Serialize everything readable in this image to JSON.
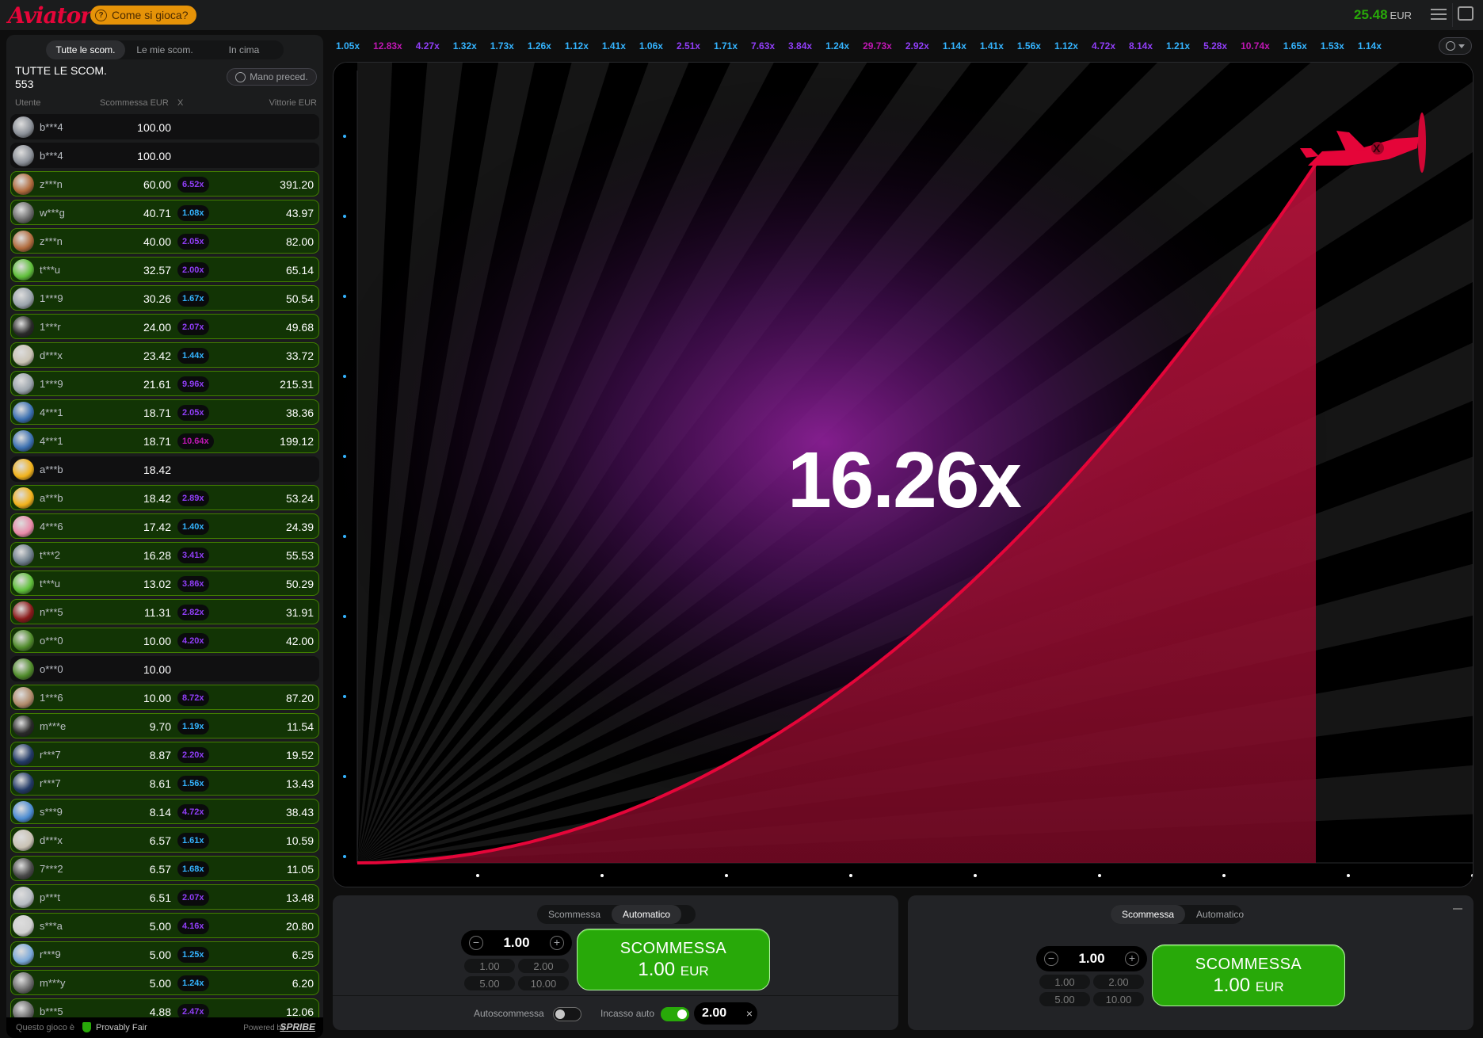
{
  "header": {
    "logo": "Aviator",
    "how_to": "Come si gioca?",
    "balance": "25.48",
    "currency": "EUR"
  },
  "left_panel": {
    "tabs": [
      "Tutte le scom.",
      "Le mie scom.",
      "In cima"
    ],
    "title": "TUTTE LE SCOM.",
    "count": "553",
    "prev_button": "Mano preced.",
    "col_user": "Utente",
    "col_bet": "Scommessa EUR",
    "col_x": "X",
    "col_win": "Vittorie EUR",
    "rows": [
      {
        "user": "b***4",
        "bet": "100.00",
        "mult": "",
        "win": "",
        "mc": "",
        "ac": "#8a8f97"
      },
      {
        "user": "b***4",
        "bet": "100.00",
        "mult": "",
        "win": "",
        "mc": "",
        "ac": "#8a8f97"
      },
      {
        "user": "z***n",
        "bet": "60.00",
        "mult": "6.52x",
        "win": "391.20",
        "mc": "#913ef8",
        "ac": "#b06a3c"
      },
      {
        "user": "w***g",
        "bet": "40.71",
        "mult": "1.08x",
        "win": "43.97",
        "mc": "#34b4ff",
        "ac": "#6a6a6a"
      },
      {
        "user": "z***n",
        "bet": "40.00",
        "mult": "2.05x",
        "win": "82.00",
        "mc": "#913ef8",
        "ac": "#b06a3c"
      },
      {
        "user": "t***u",
        "bet": "32.57",
        "mult": "2.00x",
        "win": "65.14",
        "mc": "#913ef8",
        "ac": "#5fbf3a"
      },
      {
        "user": "1***9",
        "bet": "30.26",
        "mult": "1.67x",
        "win": "50.54",
        "mc": "#34b4ff",
        "ac": "#9aa3ab"
      },
      {
        "user": "1***r",
        "bet": "24.00",
        "mult": "2.07x",
        "win": "49.68",
        "mc": "#913ef8",
        "ac": "#2a2a2a"
      },
      {
        "user": "d***x",
        "bet": "23.42",
        "mult": "1.44x",
        "win": "33.72",
        "mc": "#34b4ff",
        "ac": "#c9c2b4"
      },
      {
        "user": "1***9",
        "bet": "21.61",
        "mult": "9.96x",
        "win": "215.31",
        "mc": "#913ef8",
        "ac": "#9aa3ab"
      },
      {
        "user": "4***1",
        "bet": "18.71",
        "mult": "2.05x",
        "win": "38.36",
        "mc": "#913ef8",
        "ac": "#3a6fb0"
      },
      {
        "user": "4***1",
        "bet": "18.71",
        "mult": "10.64x",
        "win": "199.12",
        "mc": "#c017b4",
        "ac": "#3a6fb0"
      },
      {
        "user": "a***b",
        "bet": "18.42",
        "mult": "",
        "win": "",
        "mc": "",
        "ac": "#f2b21b"
      },
      {
        "user": "a***b",
        "bet": "18.42",
        "mult": "2.89x",
        "win": "53.24",
        "mc": "#913ef8",
        "ac": "#f2b21b"
      },
      {
        "user": "4***6",
        "bet": "17.42",
        "mult": "1.40x",
        "win": "24.39",
        "mc": "#34b4ff",
        "ac": "#e88aa8"
      },
      {
        "user": "t***2",
        "bet": "16.28",
        "mult": "3.41x",
        "win": "55.53",
        "mc": "#913ef8",
        "ac": "#6d7d8a"
      },
      {
        "user": "t***u",
        "bet": "13.02",
        "mult": "3.86x",
        "win": "50.29",
        "mc": "#913ef8",
        "ac": "#5fbf3a"
      },
      {
        "user": "n***5",
        "bet": "11.31",
        "mult": "2.82x",
        "win": "31.91",
        "mc": "#913ef8",
        "ac": "#8a1a1a"
      },
      {
        "user": "o***0",
        "bet": "10.00",
        "mult": "4.20x",
        "win": "42.00",
        "mc": "#913ef8",
        "ac": "#4f8a2a"
      },
      {
        "user": "o***0",
        "bet": "10.00",
        "mult": "",
        "win": "",
        "mc": "",
        "ac": "#4f8a2a"
      },
      {
        "user": "1***6",
        "bet": "10.00",
        "mult": "8.72x",
        "win": "87.20",
        "mc": "#913ef8",
        "ac": "#b08a6a"
      },
      {
        "user": "m***e",
        "bet": "9.70",
        "mult": "1.19x",
        "win": "11.54",
        "mc": "#34b4ff",
        "ac": "#2a2a2a"
      },
      {
        "user": "r***7",
        "bet": "8.87",
        "mult": "2.20x",
        "win": "19.52",
        "mc": "#913ef8",
        "ac": "#223a66"
      },
      {
        "user": "r***7",
        "bet": "8.61",
        "mult": "1.56x",
        "win": "13.43",
        "mc": "#34b4ff",
        "ac": "#223a66"
      },
      {
        "user": "s***9",
        "bet": "8.14",
        "mult": "4.72x",
        "win": "38.43",
        "mc": "#913ef8",
        "ac": "#4a8ad0"
      },
      {
        "user": "d***x",
        "bet": "6.57",
        "mult": "1.61x",
        "win": "10.59",
        "mc": "#34b4ff",
        "ac": "#c9c2b4"
      },
      {
        "user": "7***2",
        "bet": "6.57",
        "mult": "1.68x",
        "win": "11.05",
        "mc": "#34b4ff",
        "ac": "#4a4a4a"
      },
      {
        "user": "p***t",
        "bet": "6.51",
        "mult": "2.07x",
        "win": "13.48",
        "mc": "#913ef8",
        "ac": "#b7bcc2"
      },
      {
        "user": "s***a",
        "bet": "5.00",
        "mult": "4.16x",
        "win": "20.80",
        "mc": "#913ef8",
        "ac": "#d0d0d0"
      },
      {
        "user": "r***9",
        "bet": "5.00",
        "mult": "1.25x",
        "win": "6.25",
        "mc": "#34b4ff",
        "ac": "#7aa8d8"
      },
      {
        "user": "m***y",
        "bet": "5.00",
        "mult": "1.24x",
        "win": "6.20",
        "mc": "#34b4ff",
        "ac": "#6a6a6a"
      },
      {
        "user": "b***5",
        "bet": "4.88",
        "mult": "2.47x",
        "win": "12.06",
        "mc": "#913ef8",
        "ac": "#6a6a6a"
      }
    ],
    "footer_label": "Questo gioco è",
    "footer_pf": "Provably Fair",
    "footer_powered": "Powered by",
    "footer_brand": "SPRIBE"
  },
  "history": [
    {
      "v": "1.05x",
      "c": "#34b4ff"
    },
    {
      "v": "12.83x",
      "c": "#c017b4"
    },
    {
      "v": "4.27x",
      "c": "#913ef8"
    },
    {
      "v": "1.32x",
      "c": "#34b4ff"
    },
    {
      "v": "1.73x",
      "c": "#34b4ff"
    },
    {
      "v": "1.26x",
      "c": "#34b4ff"
    },
    {
      "v": "1.12x",
      "c": "#34b4ff"
    },
    {
      "v": "1.41x",
      "c": "#34b4ff"
    },
    {
      "v": "1.06x",
      "c": "#34b4ff"
    },
    {
      "v": "2.51x",
      "c": "#913ef8"
    },
    {
      "v": "1.71x",
      "c": "#34b4ff"
    },
    {
      "v": "7.63x",
      "c": "#913ef8"
    },
    {
      "v": "3.84x",
      "c": "#913ef8"
    },
    {
      "v": "1.24x",
      "c": "#34b4ff"
    },
    {
      "v": "29.73x",
      "c": "#c017b4"
    },
    {
      "v": "2.92x",
      "c": "#913ef8"
    },
    {
      "v": "1.14x",
      "c": "#34b4ff"
    },
    {
      "v": "1.41x",
      "c": "#34b4ff"
    },
    {
      "v": "1.56x",
      "c": "#34b4ff"
    },
    {
      "v": "1.12x",
      "c": "#34b4ff"
    },
    {
      "v": "4.72x",
      "c": "#913ef8"
    },
    {
      "v": "8.14x",
      "c": "#913ef8"
    },
    {
      "v": "1.21x",
      "c": "#34b4ff"
    },
    {
      "v": "5.28x",
      "c": "#913ef8"
    },
    {
      "v": "10.74x",
      "c": "#c017b4"
    },
    {
      "v": "1.65x",
      "c": "#34b4ff"
    },
    {
      "v": "1.53x",
      "c": "#34b4ff"
    },
    {
      "v": "1.14x",
      "c": "#34b4ff"
    }
  ],
  "game": {
    "multiplier": "16.26x",
    "plane_icon": "plane-icon",
    "curve_color": "#e50539"
  },
  "bet_panel_1": {
    "tabs": [
      "Scommessa",
      "Automatico"
    ],
    "amount": "1.00",
    "quick": [
      "1.00",
      "2.00",
      "5.00",
      "10.00"
    ],
    "button_label": "SCOMMESSA",
    "button_amount": "1.00",
    "button_currency": "EUR",
    "autobet_label": "Autoscommessa",
    "autocash_label": "Incasso auto",
    "autocash_value": "2.00",
    "clear": "×"
  },
  "bet_panel_2": {
    "tabs": [
      "Scommessa",
      "Automatico"
    ],
    "amount": "1.00",
    "quick": [
      "1.00",
      "2.00",
      "5.00",
      "10.00"
    ],
    "button_label": "SCOMMESSA",
    "button_amount": "1.00",
    "button_currency": "EUR"
  },
  "colors": {
    "win_green": "#28a909",
    "brand_red": "#e50539",
    "mult_blue": "#34b4ff",
    "mult_purple": "#913ef8",
    "mult_pink": "#c017b4"
  }
}
